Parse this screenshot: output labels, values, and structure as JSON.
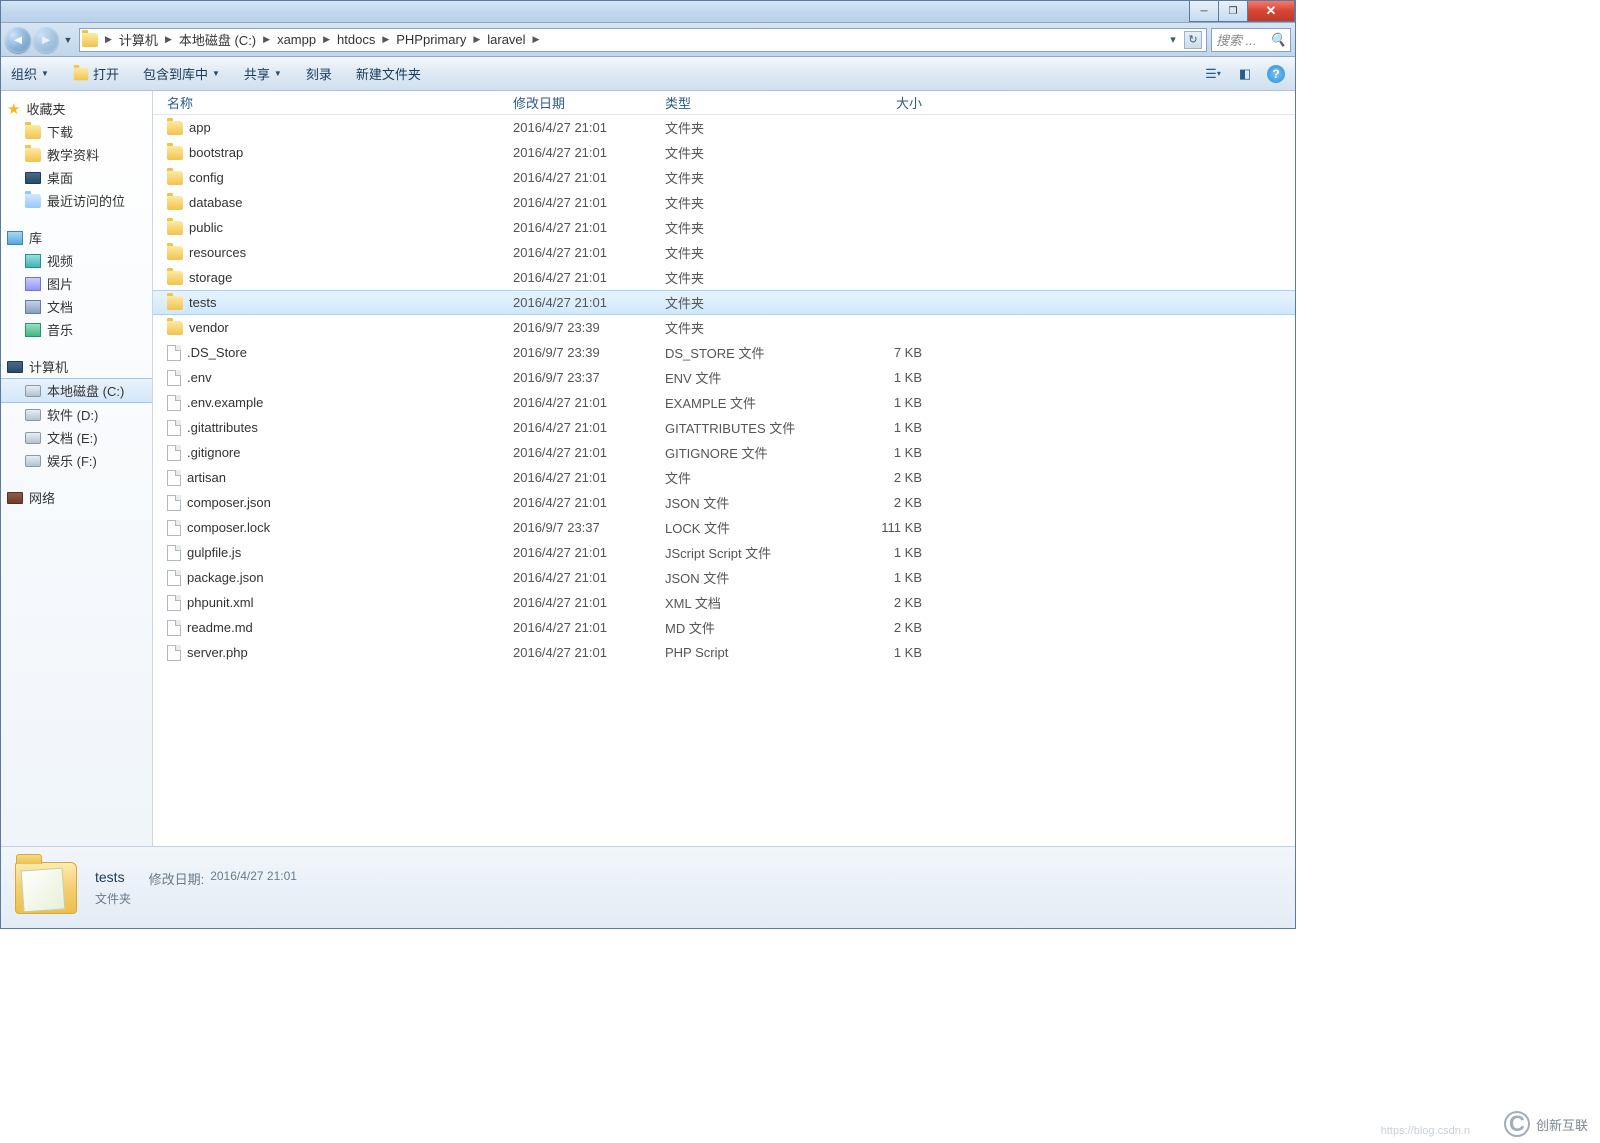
{
  "window": {
    "search_placeholder": "搜索 ..."
  },
  "breadcrumbs": [
    "计算机",
    "本地磁盘 (C:)",
    "xampp",
    "htdocs",
    "PHPprimary",
    "laravel"
  ],
  "toolbar": {
    "organize": "组织",
    "open": "打开",
    "include": "包含到库中",
    "share": "共享",
    "burn": "刻录",
    "newfolder": "新建文件夹"
  },
  "sidebar": {
    "favorites_label": "收藏夹",
    "favorites": [
      "下载",
      "教学资料",
      "桌面",
      "最近访问的位"
    ],
    "libraries_label": "库",
    "libraries": [
      "视频",
      "图片",
      "文档",
      "音乐"
    ],
    "computer_label": "计算机",
    "drives": [
      "本地磁盘 (C:)",
      "软件 (D:)",
      "文档 (E:)",
      "娱乐 (F:)"
    ],
    "network_label": "网络"
  },
  "columns": {
    "name": "名称",
    "date": "修改日期",
    "type": "类型",
    "size": "大小"
  },
  "files": [
    {
      "icon": "folder",
      "name": "app",
      "date": "2016/4/27 21:01",
      "type": "文件夹",
      "size": ""
    },
    {
      "icon": "folder",
      "name": "bootstrap",
      "date": "2016/4/27 21:01",
      "type": "文件夹",
      "size": ""
    },
    {
      "icon": "folder",
      "name": "config",
      "date": "2016/4/27 21:01",
      "type": "文件夹",
      "size": ""
    },
    {
      "icon": "folder",
      "name": "database",
      "date": "2016/4/27 21:01",
      "type": "文件夹",
      "size": ""
    },
    {
      "icon": "folder",
      "name": "public",
      "date": "2016/4/27 21:01",
      "type": "文件夹",
      "size": ""
    },
    {
      "icon": "folder",
      "name": "resources",
      "date": "2016/4/27 21:01",
      "type": "文件夹",
      "size": ""
    },
    {
      "icon": "folder",
      "name": "storage",
      "date": "2016/4/27 21:01",
      "type": "文件夹",
      "size": ""
    },
    {
      "icon": "folder",
      "name": "tests",
      "date": "2016/4/27 21:01",
      "type": "文件夹",
      "size": "",
      "selected": true
    },
    {
      "icon": "folder",
      "name": "vendor",
      "date": "2016/9/7 23:39",
      "type": "文件夹",
      "size": ""
    },
    {
      "icon": "file",
      "name": ".DS_Store",
      "date": "2016/9/7 23:39",
      "type": "DS_STORE 文件",
      "size": "7 KB"
    },
    {
      "icon": "file",
      "name": ".env",
      "date": "2016/9/7 23:37",
      "type": "ENV 文件",
      "size": "1 KB"
    },
    {
      "icon": "file",
      "name": ".env.example",
      "date": "2016/4/27 21:01",
      "type": "EXAMPLE 文件",
      "size": "1 KB"
    },
    {
      "icon": "file",
      "name": ".gitattributes",
      "date": "2016/4/27 21:01",
      "type": "GITATTRIBUTES 文件",
      "size": "1 KB"
    },
    {
      "icon": "file",
      "name": ".gitignore",
      "date": "2016/4/27 21:01",
      "type": "GITIGNORE 文件",
      "size": "1 KB"
    },
    {
      "icon": "file",
      "name": "artisan",
      "date": "2016/4/27 21:01",
      "type": "文件",
      "size": "2 KB"
    },
    {
      "icon": "file",
      "name": "composer.json",
      "date": "2016/4/27 21:01",
      "type": "JSON 文件",
      "size": "2 KB"
    },
    {
      "icon": "file",
      "name": "composer.lock",
      "date": "2016/9/7 23:37",
      "type": "LOCK 文件",
      "size": "111 KB"
    },
    {
      "icon": "file",
      "name": "gulpfile.js",
      "date": "2016/4/27 21:01",
      "type": "JScript Script 文件",
      "size": "1 KB"
    },
    {
      "icon": "file",
      "name": "package.json",
      "date": "2016/4/27 21:01",
      "type": "JSON 文件",
      "size": "1 KB"
    },
    {
      "icon": "file",
      "name": "phpunit.xml",
      "date": "2016/4/27 21:01",
      "type": "XML 文档",
      "size": "2 KB"
    },
    {
      "icon": "file",
      "name": "readme.md",
      "date": "2016/4/27 21:01",
      "type": "MD 文件",
      "size": "2 KB"
    },
    {
      "icon": "file",
      "name": "server.php",
      "date": "2016/4/27 21:01",
      "type": "PHP Script",
      "size": "1 KB"
    }
  ],
  "details": {
    "title": "tests",
    "type": "文件夹",
    "meta_label": "修改日期:",
    "meta_value": "2016/4/27 21:01"
  },
  "watermark": {
    "brand": "创新互联",
    "url": "https://blog.csdn.n"
  }
}
